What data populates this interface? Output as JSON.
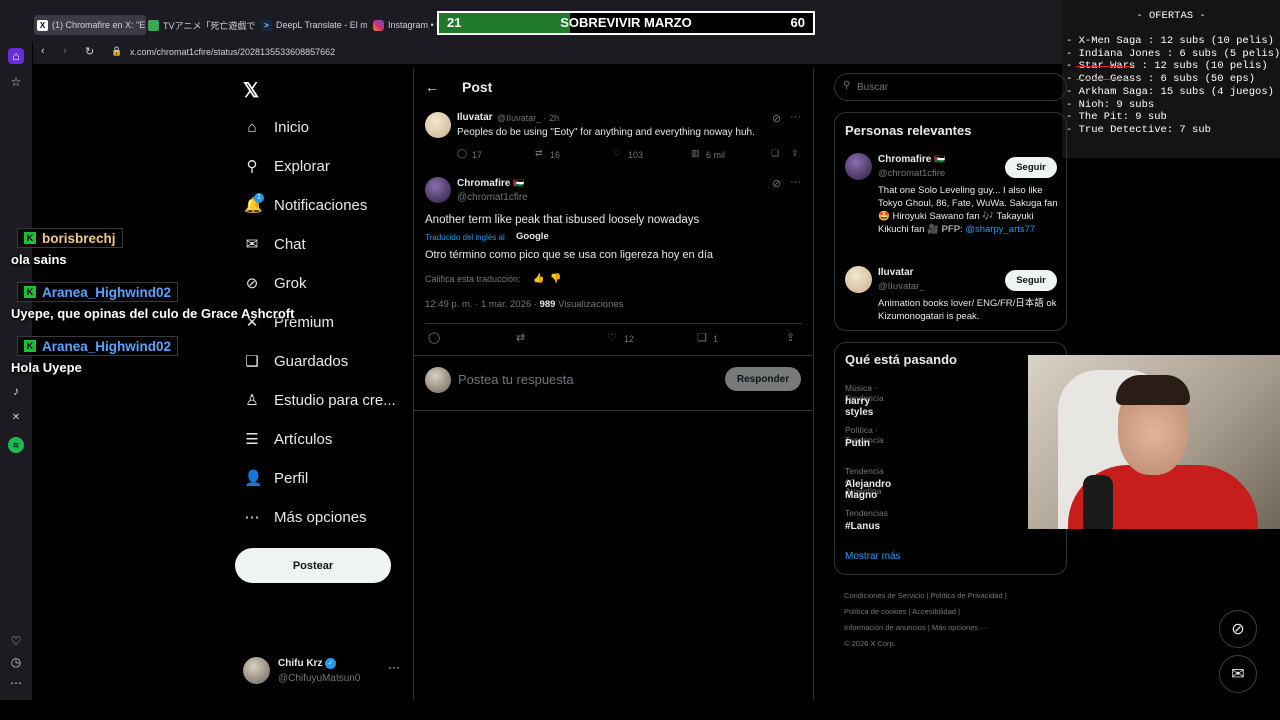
{
  "browser": {
    "tabs": [
      {
        "label": "(1) Chromafire en X: \"E",
        "color": "#000000",
        "active": true
      },
      {
        "label": "TVアニメ「死亡遊戯で飯を食",
        "color": "#3aa757",
        "active": false
      },
      {
        "label": "DeepL Translate - El mejo",
        "color": "#0f2b46",
        "active": false
      },
      {
        "label": "Instagram • M",
        "color": "#d62976",
        "active": false
      }
    ],
    "url": "x.com/chromat1cfire/status/2028135533608857662"
  },
  "counter": {
    "left": "21",
    "title": "SOBREVIVIR MARZO",
    "right": "60",
    "progress": 0.35
  },
  "ofertas": {
    "title": "- OFERTAS -",
    "lines": [
      {
        "text": "- X-Men Saga : 12 subs (10 pelis)",
        "struck": false
      },
      {
        "text": "- Indiana Jones : 6 subs (5 pelis)",
        "struck": false
      },
      {
        "text": "- Star Wars : 12 subs (10 pelis)",
        "struck": true
      },
      {
        "text": "- Code Geass : 6 subs (50 eps)",
        "struck": true
      },
      {
        "text": "- Arkham Saga: 15 subs (4 juegos)",
        "struck": false
      },
      {
        "text": "- Nioh: 9 subs",
        "struck": false
      },
      {
        "text": "- The Pit: 9 sub",
        "struck": false
      },
      {
        "text": "- True Detective: 7 sub",
        "struck": false
      }
    ]
  },
  "nav": {
    "items": [
      {
        "label": "Inicio",
        "icon": "home-icon",
        "glyph": "⌂"
      },
      {
        "label": "Explorar",
        "icon": "search-icon",
        "glyph": "⚲"
      },
      {
        "label": "Notificaciones",
        "icon": "bell-icon",
        "glyph": "🔔"
      },
      {
        "label": "Chat",
        "icon": "mail-icon",
        "glyph": "✉"
      },
      {
        "label": "Grok",
        "icon": "grok-icon",
        "glyph": "⊘"
      },
      {
        "label": "Premium",
        "icon": "x-icon",
        "glyph": "✕"
      },
      {
        "label": "Guardados",
        "icon": "bookmark-icon",
        "glyph": "❏"
      },
      {
        "label": "Estudio para cre...",
        "icon": "studio-icon",
        "glyph": "♙"
      },
      {
        "label": "Artículos",
        "icon": "article-icon",
        "glyph": "☰"
      },
      {
        "label": "Perfil",
        "icon": "person-icon",
        "glyph": "👤"
      },
      {
        "label": "Más opciones",
        "icon": "more-icon",
        "glyph": "⋯"
      }
    ],
    "notif_badge": "1",
    "post_button": "Postear"
  },
  "account": {
    "name": "Chifu Krz",
    "handle": "@ChifuyuMatsun0"
  },
  "post": {
    "header": "Post",
    "parent": {
      "name": "Iluvatar",
      "handle": "@IIuvatar_ · 2h",
      "text": "Peoples do be using \"Eoty\" for anything and everything noway huh.",
      "replies": "17",
      "reposts": "16",
      "likes": "103",
      "views": "6 mil"
    },
    "main": {
      "name": "Chromafire",
      "flag": "🇵🇸",
      "handle": "@chromat1cfire",
      "text": "Another term like peak that isbused loosely nowadays",
      "translated_by": "Traducido del inglés al",
      "translator": "Google",
      "translation": "Otro término como pico que se usa con ligereza hoy en día",
      "rate": "Califica esta traducción:",
      "meta_time": "12:49 p. m. · 1 mar. 2026 · ",
      "meta_views": "989",
      "meta_views_label": " Visualizaciones",
      "likes": "12",
      "bookmarks": "1"
    },
    "reply_placeholder": "Postea tu respuesta",
    "reply_button": "Responder"
  },
  "sidebar": {
    "search_placeholder": "Buscar",
    "relevant_title": "Personas relevantes",
    "people": [
      {
        "name": "Chromafire",
        "handle": "@chromat1cfire",
        "button": "Seguir",
        "bio": "That one Solo Leveling guy... I also like Tokyo Ghoul, 86, Fate, WuWa. Sakuga fan 🤩 Hiroyuki Sawano fan 🎶 Takayuki Kikuchi fan 🎥 PFP:",
        "link": "@sharpy_arts77"
      },
      {
        "name": "Iluvatar",
        "handle": "@IIuvatar_",
        "button": "Seguir",
        "bio": "Animation books lover/ ENG/FR/日本語 ok Kizumonogatari is peak.",
        "link": ""
      }
    ],
    "trends_title": "Qué está pasando",
    "trends": [
      {
        "category": "Música · Tendencia",
        "name": "harry styles"
      },
      {
        "category": "Política · Tendencia",
        "name": "Putin"
      },
      {
        "category": "Tendencia en Argentina",
        "name": "Alejandro Magno"
      },
      {
        "category": "Tendencias",
        "name": "#Lanus"
      }
    ],
    "show_more": "Mostrar más",
    "footer": [
      "Condiciones de Servicio",
      "Política de Privacidad",
      "Política de cookies",
      "Accesibilidad",
      "Información de anuncios",
      "Más opciones ···",
      "© 2026 X Corp."
    ]
  },
  "chat": [
    {
      "user": "borisbrechj",
      "color": "#f0c98a",
      "message": "ola sains"
    },
    {
      "user": "Aranea_Highwind02",
      "color": "#5aa3ff",
      "message": "Uyepe, que opinas del culo de Grace Ashcroft"
    },
    {
      "user": "Aranea_Highwind02",
      "color": "#5aa3ff",
      "message": "Hola Uyepe"
    }
  ]
}
